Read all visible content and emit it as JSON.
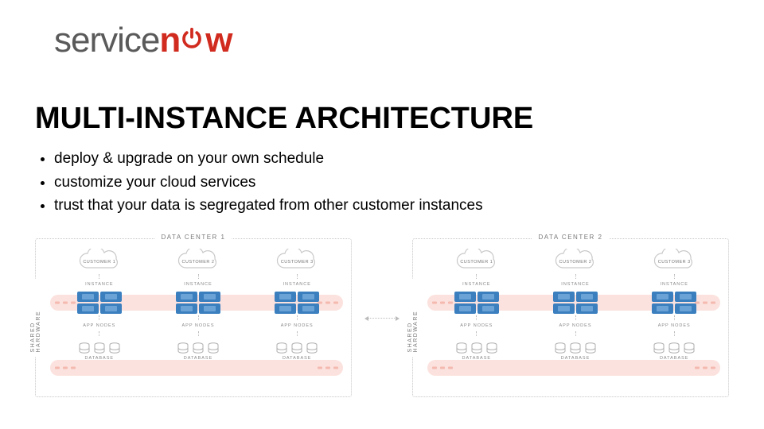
{
  "logo": {
    "word1": "service",
    "word2_pre": "n",
    "word2_post": "w"
  },
  "title": "MULTI-INSTANCE ARCHITECTURE",
  "bullets": [
    "deploy & upgrade on your own schedule",
    "customize your cloud services",
    "trust that your data is segregated from other customer instances"
  ],
  "diagram": {
    "shared_hw_label": "SHARED HARDWARE",
    "datacenters": [
      {
        "title": "DATA CENTER 1",
        "customers": [
          "CUSTOMER 1",
          "CUSTOMER 2",
          "CUSTOMER 3"
        ]
      },
      {
        "title": "DATA CENTER 2",
        "customers": [
          "CUSTOMER 1",
          "CUSTOMER 2",
          "CUSTOMER 3"
        ]
      }
    ],
    "tier_labels": {
      "instance": "INSTANCE",
      "app_nodes": "APP NODES",
      "database": "DATABASE"
    }
  }
}
